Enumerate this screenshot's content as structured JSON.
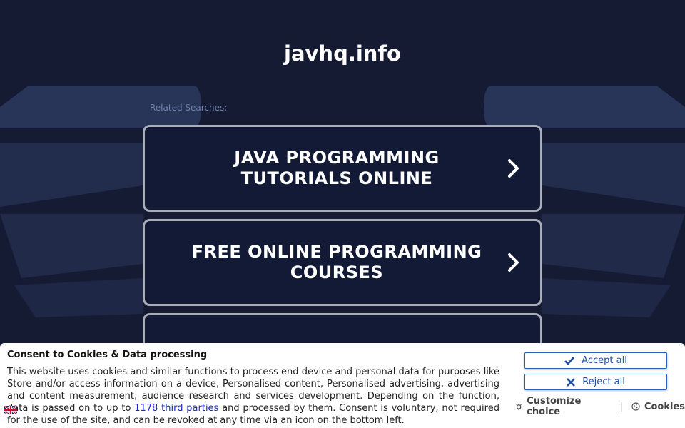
{
  "domain": "javhq.info",
  "related_label": "Related Searches:",
  "searches": [
    {
      "label": "JAVA PROGRAMMING TUTORIALS ONLINE"
    },
    {
      "label": "FREE ONLINE PROGRAMMING COURSES"
    },
    {
      "label": ""
    }
  ],
  "consent": {
    "title": "Consent to Cookies & Data processing",
    "text_before_link": "This website uses cookies and similar functions to process end device and personal data for purposes like Store and/or access information on a device, Personalised content, Personalised advertising, advertising and content measurement, audience research and services development. Depending on the function, data is passed on to up to ",
    "link_text": "1178 third parties",
    "text_after_link": " and processed by them. Consent is voluntary, not required for the use of the site, and can be revoked at any time via an icon on the bottom left.",
    "accept_label": "Accept all",
    "reject_label": "Reject all",
    "customize_label": "Customize choice",
    "cookies_label": "Cookies"
  },
  "colors": {
    "background": "#151b33",
    "card_border": "#a8adb8",
    "accent_blue": "#1f4fa3",
    "link_blue": "#1a27c9"
  },
  "icons": [
    "chevron-right-icon",
    "check-icon",
    "x-icon",
    "gear-icon",
    "cookie-icon",
    "flag-uk-icon"
  ]
}
